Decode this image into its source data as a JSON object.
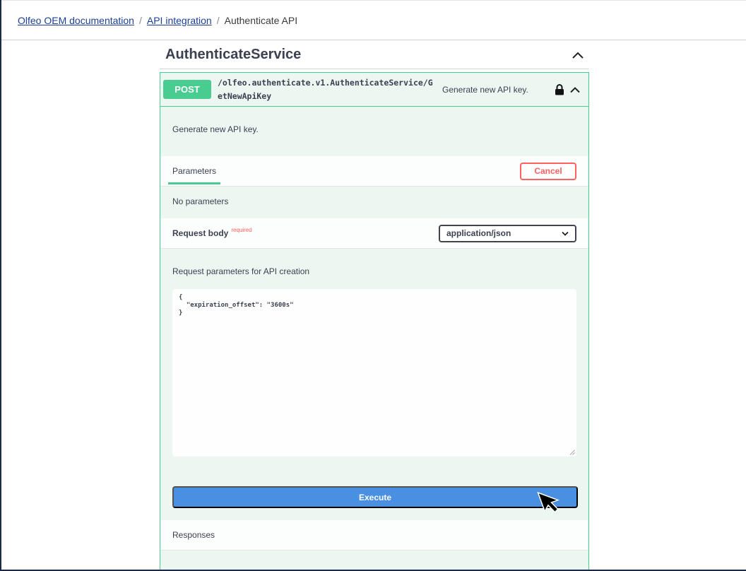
{
  "breadcrumb": {
    "items": [
      "Olfeo OEM documentation",
      "API integration"
    ],
    "current": "Authenticate API",
    "separator": "/"
  },
  "section": {
    "title": "AuthenticateService"
  },
  "operation": {
    "method": "POST",
    "path": "/olfeo.authenticate.v1.AuthenticateService/GetNewApiKey",
    "summary": "Generate new API key.",
    "description": "Generate new API key.",
    "method_color": "#49cc90"
  },
  "parameters": {
    "tab_label": "Parameters",
    "cancel_label": "Cancel",
    "empty_text": "No parameters"
  },
  "request_body": {
    "label": "Request body",
    "required_label": "required",
    "content_type": "application/json",
    "description": "Request parameters for API creation",
    "value": "{\n  \"expiration_offset\": \"3600s\"\n}"
  },
  "execute": {
    "label": "Execute",
    "color": "#4990e2"
  },
  "responses": {
    "label": "Responses"
  },
  "icons": {
    "lock": "lock-icon",
    "collapse": "chevron-up-icon",
    "select": "chevron-down-icon",
    "cursor": "mouse-pointer-icon"
  }
}
